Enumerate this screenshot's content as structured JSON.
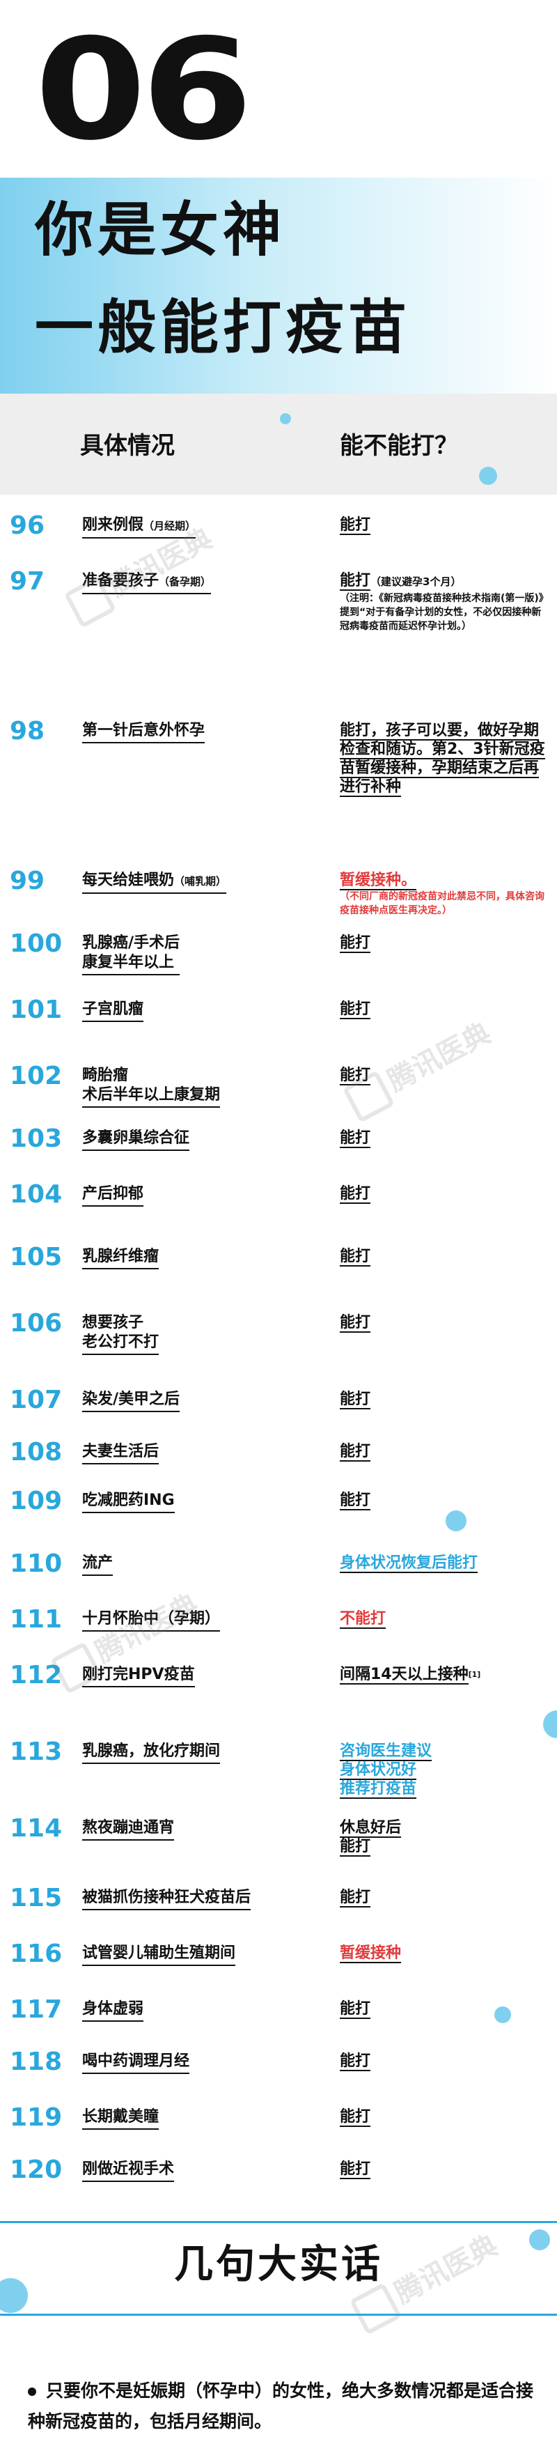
{
  "header": {
    "number": "06",
    "title_line1": "你是女神",
    "title_line2": "一般能打疫苗"
  },
  "table_header": {
    "col1": "具体情况",
    "col2": "能不能打？"
  },
  "watermark": "腾讯医典",
  "rows": [
    {
      "num": "96",
      "cond": "刚来例假",
      "cond_note": "（月经期）",
      "ans": "能打"
    },
    {
      "num": "97",
      "cond": "准备要孩子",
      "cond_note": "（备孕期）",
      "ans": "能打",
      "ans_note": "（建议避孕3个月）",
      "ans_detail": "（注明：《新冠病毒疫苗接种技术指南(第一版)》提到“对于有备孕计划的女性，不必仅因接种新冠病毒疫苗而延迟怀孕计划。）"
    },
    {
      "num": "98",
      "cond": "第一针后意外怀孕",
      "ans": "能打，孩子可以要，做好孕期检查和随访。第2、3针新冠疫苗暂缓接种，孕期结束之后再进行补种"
    },
    {
      "num": "99",
      "cond": "每天给娃喂奶",
      "cond_note": "（哺乳期）",
      "ans": "暂缓接种。",
      "ans_detail": "（不同厂商的新冠疫苗对此禁忌不同，具体咨询疫苗接种点医生再决定。）",
      "ans_class": "red"
    },
    {
      "num": "100",
      "cond": "乳腺癌/手术后 康复半年以上",
      "ans": "能打"
    },
    {
      "num": "101",
      "cond": "子宫肌瘤",
      "ans": "能打"
    },
    {
      "num": "102",
      "cond": "畸胎瘤 术后半年以上康复期",
      "ans": "能打"
    },
    {
      "num": "103",
      "cond": "多囊卵巢综合征",
      "ans": "能打"
    },
    {
      "num": "104",
      "cond": "产后抑郁",
      "ans": "能打"
    },
    {
      "num": "105",
      "cond": "乳腺纤维瘤",
      "ans": "能打"
    },
    {
      "num": "106",
      "cond": "想要孩子 老公打不打",
      "ans": "能打"
    },
    {
      "num": "107",
      "cond": "染发/美甲之后",
      "ans": "能打"
    },
    {
      "num": "108",
      "cond": "夫妻生活后",
      "ans": "能打"
    },
    {
      "num": "109",
      "cond": "吃减肥药ING",
      "ans": "能打"
    },
    {
      "num": "110",
      "cond": "流产",
      "ans": "身体状况恢复后能打",
      "ans_class": "blue"
    },
    {
      "num": "111",
      "cond": "十月怀胎中（孕期）",
      "ans": "不能打",
      "ans_class": "red"
    },
    {
      "num": "112",
      "cond": "刚打完HPV疫苗",
      "ans": "间隔14天以上接种",
      "ans_sup": "[1]"
    },
    {
      "num": "113",
      "cond": "乳腺癌，放化疗期间",
      "ans": "咨询医生建议 身体状况好 推荐打疫苗",
      "ans_class": "blue"
    },
    {
      "num": "114",
      "cond": "熬夜蹦迪通宵",
      "ans": "休息好后 能打"
    },
    {
      "num": "115",
      "cond": "被猫抓伤接种狂犬疫苗后",
      "ans": "能打"
    },
    {
      "num": "116",
      "cond": "试管婴儿辅助生殖期间",
      "ans": "暂缓接种",
      "ans_class": "red"
    },
    {
      "num": "117",
      "cond": "身体虚弱",
      "ans": "能打"
    },
    {
      "num": "118",
      "cond": "喝中药调理月经",
      "ans": "能打"
    },
    {
      "num": "119",
      "cond": "长期戴美瞳",
      "ans": "能打"
    },
    {
      "num": "120",
      "cond": "刚做近视手术",
      "ans": "能打"
    }
  ],
  "bottom": {
    "title": "几句大实话",
    "text": "只要你不是妊娠期（怀孕中）的女性，绝大多数情况都是适合接种新冠疫苗的，包括月经期间。"
  },
  "colors": {
    "accent": "#29a7dc",
    "accent_light": "#7fd0ef",
    "warning": "#e23b3b"
  }
}
